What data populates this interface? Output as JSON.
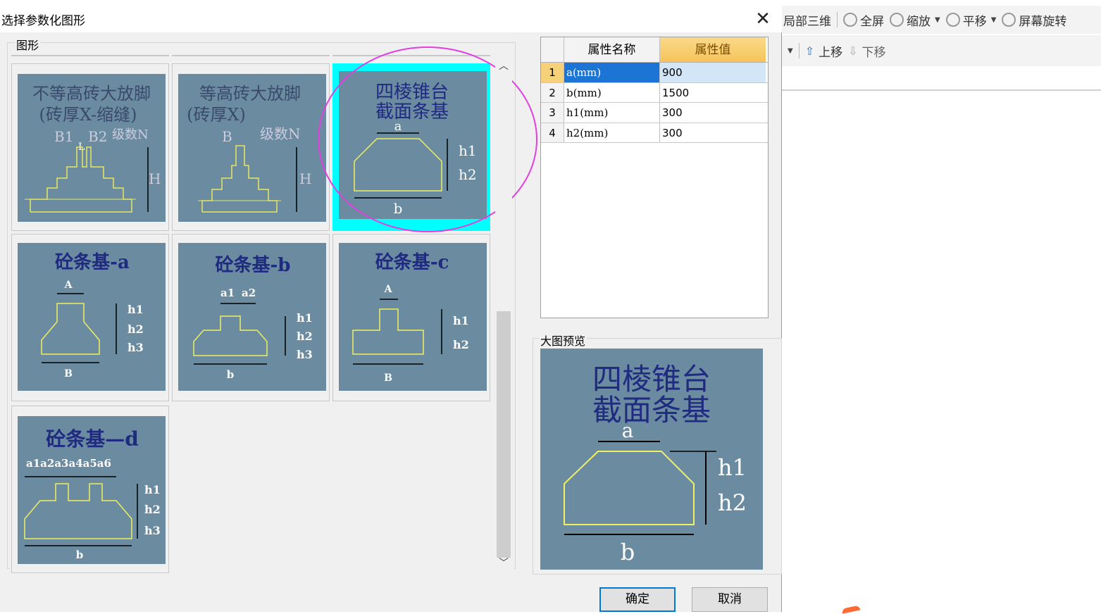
{
  "background_app": {
    "toolbar1": [
      {
        "label": "局部三维",
        "icon": "cube-icon"
      },
      {
        "label": "全屏",
        "icon": "zoom-in-icon"
      },
      {
        "label": "缩放",
        "icon": "zoom-icon"
      },
      {
        "label": "平移",
        "icon": "pan-icon"
      },
      {
        "label": "屏幕旋转",
        "icon": "rotate-icon"
      }
    ],
    "toolbar2": {
      "move_up": "上移",
      "move_down": "下移"
    }
  },
  "dialog": {
    "title": "选择参数化图形",
    "close_glyph": "✕",
    "shapes_legend": "图形",
    "preview_legend": "大图预览",
    "ok_label": "确定",
    "cancel_label": "取消"
  },
  "shapes": [
    {
      "title_line1": "不等高砖大放脚",
      "title_line2": "(砖厚X-缩缝)",
      "labels": [
        "B1",
        "L",
        "B2",
        "级数N",
        "H"
      ],
      "selected": false
    },
    {
      "title_line1": "等高砖大放脚",
      "title_line2": "(砖厚X)",
      "labels": [
        "B",
        "级数N",
        "H"
      ],
      "selected": false
    },
    {
      "title_line1": "四棱锥台",
      "title_line2": "截面条基",
      "labels": [
        "a",
        "h1",
        "h2",
        "b"
      ],
      "selected": true
    },
    {
      "title_line1": "砼条基-a",
      "labels": [
        "A",
        "h1",
        "h2",
        "h3",
        "B"
      ],
      "selected": false
    },
    {
      "title_line1": "砼条基-b",
      "labels": [
        "a1",
        "a2",
        "h1",
        "h2",
        "h3",
        "b"
      ],
      "selected": false
    },
    {
      "title_line1": "砼条基-c",
      "labels": [
        "A",
        "h1",
        "h2",
        "B"
      ],
      "selected": false
    },
    {
      "title_line1": "砼条基—d",
      "labels": [
        "a1a2a3a4a5a6",
        "h1",
        "h2",
        "h3",
        "b"
      ],
      "selected": false
    }
  ],
  "property_grid": {
    "col_name": "属性名称",
    "col_value": "属性值",
    "rows": [
      {
        "num": "1",
        "name": "a(mm)",
        "value": "900"
      },
      {
        "num": "2",
        "name": "b(mm)",
        "value": "1500"
      },
      {
        "num": "3",
        "name": "h1(mm)",
        "value": "300"
      },
      {
        "num": "4",
        "name": "h2(mm)",
        "value": "300"
      }
    ]
  },
  "preview": {
    "title_line1": "四棱锥台",
    "title_line2": "截面条基",
    "labels": [
      "a",
      "h1",
      "h2",
      "b"
    ]
  },
  "colors": {
    "thumb_bg": "#6a8ba0",
    "thumb_title": "#1f2a80",
    "outline": "#f0f060",
    "selection": "#00ffff",
    "annotation": "#e040e0"
  }
}
